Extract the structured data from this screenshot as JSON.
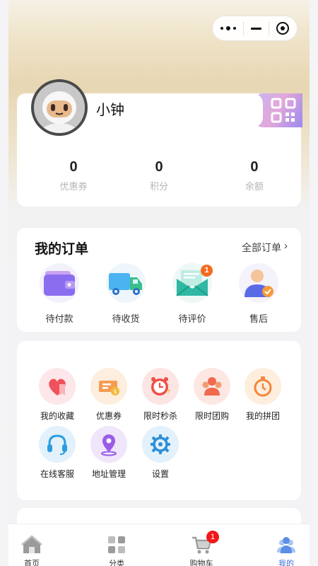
{
  "profile": {
    "username": "小钟",
    "stats": [
      {
        "value": "0",
        "label": "优惠券"
      },
      {
        "value": "0",
        "label": "积分"
      },
      {
        "value": "0",
        "label": "余额"
      }
    ]
  },
  "orders": {
    "title": "我的订单",
    "all_label": "全部订单",
    "arrow": "›",
    "items": [
      {
        "label": "待付款",
        "icon": "wallet-icon"
      },
      {
        "label": "待收货",
        "icon": "truck-icon"
      },
      {
        "label": "待评价",
        "icon": "envelope-icon",
        "badge": "1"
      },
      {
        "label": "售后",
        "icon": "customer-service-person-icon"
      }
    ]
  },
  "services": {
    "items": [
      {
        "label": "我的收藏",
        "icon": "heart-bookmark-icon"
      },
      {
        "label": "优惠券",
        "icon": "coupon-ticket-icon"
      },
      {
        "label": "限时秒杀",
        "icon": "alarm-clock-icon"
      },
      {
        "label": "限时团购",
        "icon": "group-people-icon"
      },
      {
        "label": "我的拼团",
        "icon": "stopwatch-icon"
      },
      {
        "label": "在线客服",
        "icon": "headset-icon"
      },
      {
        "label": "地址管理",
        "icon": "location-pin-icon"
      },
      {
        "label": "设置",
        "icon": "gear-icon"
      }
    ]
  },
  "tabbar": {
    "items": [
      {
        "label": "首页",
        "icon": "home-icon"
      },
      {
        "label": "分类",
        "icon": "category-grid-icon"
      },
      {
        "label": "购物车",
        "icon": "cart-icon",
        "badge": "1"
      },
      {
        "label": "我的",
        "icon": "profile-people-icon",
        "active": true
      }
    ]
  },
  "colors": {
    "accent": "#3b6fd8",
    "badge_orange": "#f36b1c",
    "badge_red": "#f01919"
  }
}
